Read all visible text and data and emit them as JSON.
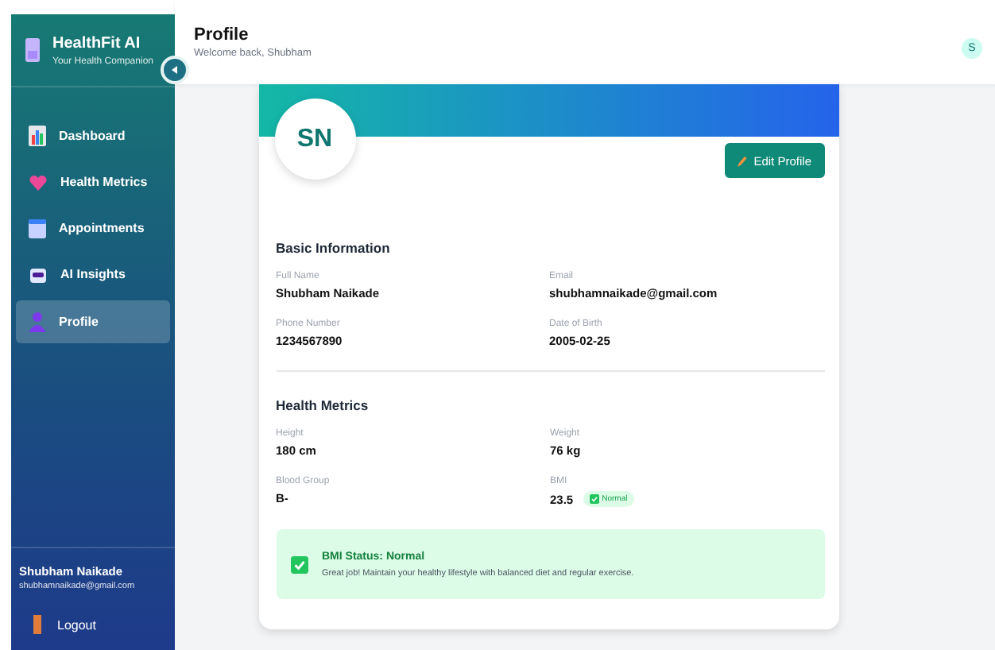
{
  "brand": {
    "title": "HealthFit AI",
    "subtitle": "Your Health Companion"
  },
  "nav": [
    {
      "label": "Dashboard",
      "selected": false
    },
    {
      "label": "Health Metrics",
      "selected": false
    },
    {
      "label": "Appointments",
      "selected": false
    },
    {
      "label": "AI Insights",
      "selected": false
    },
    {
      "label": "Profile",
      "selected": true
    }
  ],
  "user": {
    "name": "Shubham Naikade",
    "email": "shubhamnaikade@gmail.com"
  },
  "logout": "Logout",
  "header": {
    "title": "Profile",
    "subtitle": "Welcome back, Shubham",
    "avatar": "S"
  },
  "profile": {
    "initials": "SN",
    "edit_button": "Edit Profile",
    "sections": [
      {
        "title": "Basic Information",
        "fields": [
          {
            "label": "Full Name",
            "value": "Shubham Naikade"
          },
          {
            "label": "Email",
            "value": "shubhamnaikade@gmail.com"
          },
          {
            "label": "Phone Number",
            "value": "1234567890"
          },
          {
            "label": "Date of Birth",
            "value": "2005-02-25"
          }
        ]
      },
      {
        "title": "Health Metrics",
        "fields": [
          {
            "label": "Height",
            "value": "180 cm"
          },
          {
            "label": "Weight",
            "value": "76 kg"
          },
          {
            "label": "Blood Group",
            "value": "B-"
          },
          {
            "label": "BMI",
            "value": "23.5",
            "badge": "Normal"
          }
        ]
      }
    ],
    "alert": {
      "title": "BMI Status: Normal",
      "message": "Great job! Maintain your healthy lifestyle with balanced diet and regular exercise."
    }
  }
}
